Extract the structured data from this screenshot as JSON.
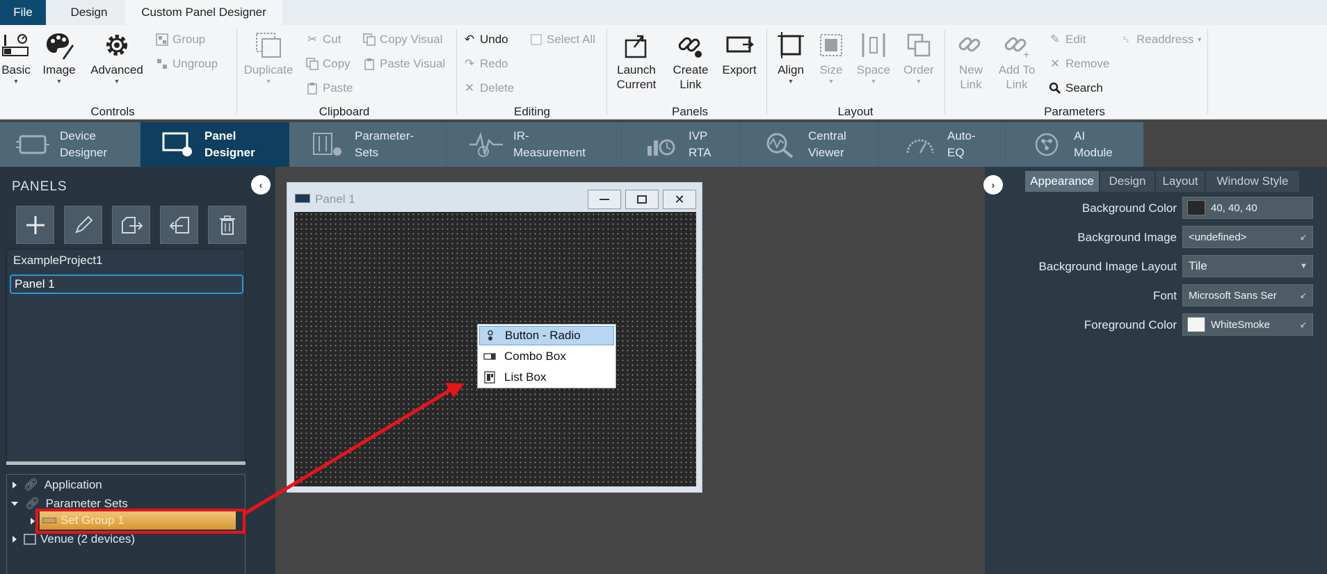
{
  "top_tabs": {
    "file": "File",
    "design": "Design",
    "custom": "Custom Panel Designer"
  },
  "ribbon": {
    "controls": {
      "label": "Controls",
      "basic": "Basic",
      "image": "Image",
      "advanced": "Advanced",
      "group": "Group",
      "ungroup": "Ungroup"
    },
    "clipboard": {
      "label": "Clipboard",
      "duplicate": "Duplicate",
      "cut": "Cut",
      "copy": "Copy",
      "paste": "Paste",
      "copy_visual": "Copy Visual",
      "paste_visual": "Paste Visual"
    },
    "editing": {
      "label": "Editing",
      "undo": "Undo",
      "redo": "Redo",
      "delete": "Delete",
      "select_all": "Select All"
    },
    "panels": {
      "label": "Panels",
      "launch_1": "Launch",
      "launch_2": "Current",
      "create_1": "Create",
      "create_2": "Link",
      "export": "Export"
    },
    "layout": {
      "label": "Layout",
      "align": "Align",
      "size": "Size",
      "space": "Space",
      "order": "Order"
    },
    "parameters": {
      "label": "Parameters",
      "new_1": "New",
      "new_2": "Link",
      "add_1": "Add To",
      "add_2": "Link",
      "edit": "Edit",
      "remove": "Remove",
      "search": "Search",
      "readdress": "Readdress"
    }
  },
  "modules": [
    {
      "l1": "Device",
      "l2": "Designer"
    },
    {
      "l1": "Panel",
      "l2": "Designer"
    },
    {
      "l1": "Parameter-",
      "l2": "Sets"
    },
    {
      "l1": "IR-",
      "l2": "Measurement"
    },
    {
      "l1": "IVP",
      "l2": "RTA"
    },
    {
      "l1": "Central",
      "l2": "Viewer"
    },
    {
      "l1": "Auto-",
      "l2": "EQ"
    },
    {
      "l1": "AI",
      "l2": "Module"
    }
  ],
  "left": {
    "title": "PANELS",
    "project": "ExampleProject1",
    "panel_item": "Panel 1",
    "tree": {
      "application": "Application",
      "parameter_sets": "Parameter Sets",
      "set_group": "Set Group 1",
      "venue": "Venue (2 devices)"
    }
  },
  "panel_window": {
    "title": "Panel 1",
    "context_menu": [
      "Button - Radio",
      "Combo Box",
      "List Box"
    ]
  },
  "properties": {
    "tabs": [
      "Appearance",
      "Design",
      "Layout",
      "Window Style"
    ],
    "rows": [
      {
        "label": "Background Color",
        "value": "40, 40, 40",
        "swatch": "#282828"
      },
      {
        "label": "Background Image",
        "value": "<undefined>"
      },
      {
        "label": "Background Image Layout",
        "value": "Tile"
      },
      {
        "label": "Font",
        "value": "Microsoft Sans Ser"
      },
      {
        "label": "Foreground Color",
        "value": "WhiteSmoke",
        "swatch": "#f5f5f5"
      }
    ]
  },
  "colors": {
    "accent": "#0e4a70",
    "annotation": "#e8141b",
    "highlight": "#e3a74a"
  }
}
